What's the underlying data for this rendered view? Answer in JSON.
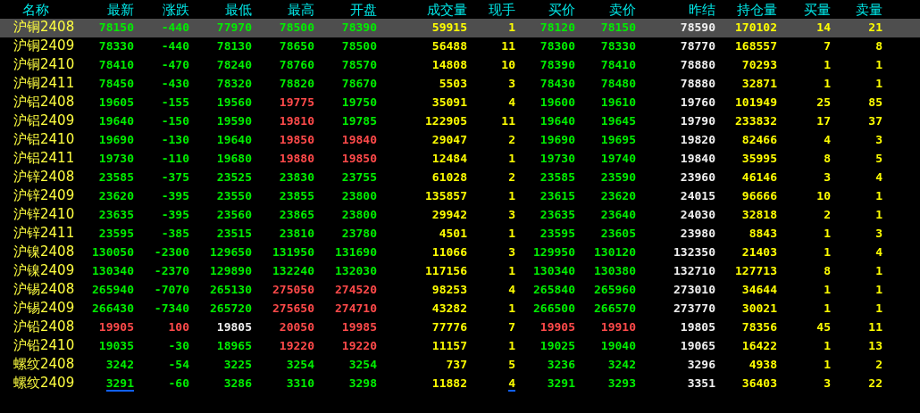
{
  "columns": [
    {
      "label": "名称",
      "marked": false
    },
    {
      "label": "最新",
      "marked": true
    },
    {
      "label": "涨跌",
      "marked": false
    },
    {
      "label": "最低",
      "marked": false
    },
    {
      "label": "最高",
      "marked": false
    },
    {
      "label": "开盘",
      "marked": false
    },
    {
      "label": "成交量",
      "marked": false
    },
    {
      "label": "现手",
      "marked": true
    },
    {
      "label": "买价",
      "marked": false
    },
    {
      "label": "卖价",
      "marked": false
    },
    {
      "label": "昨结",
      "marked": false
    },
    {
      "label": "持仓量",
      "marked": false
    },
    {
      "label": "买量",
      "marked": false
    },
    {
      "label": "卖量",
      "marked": false
    }
  ],
  "rows": [
    {
      "selected": true,
      "cells": [
        {
          "text": "沪铜2408",
          "color": "#ffff40"
        },
        {
          "text": "78150",
          "color": "#00ee00"
        },
        {
          "text": "-440",
          "color": "#00ee00"
        },
        {
          "text": "77970",
          "color": "#00ee00"
        },
        {
          "text": "78500",
          "color": "#00ee00"
        },
        {
          "text": "78390",
          "color": "#00ee00"
        },
        {
          "text": "59915",
          "color": "#ffff00"
        },
        {
          "text": "1",
          "color": "#ffff00"
        },
        {
          "text": "78120",
          "color": "#00ee00"
        },
        {
          "text": "78150",
          "color": "#00ee00"
        },
        {
          "text": "78590",
          "color": "#f0f0f0"
        },
        {
          "text": "170102",
          "color": "#ffff00"
        },
        {
          "text": "14",
          "color": "#ffff00"
        },
        {
          "text": "21",
          "color": "#ffff00"
        }
      ]
    },
    {
      "selected": false,
      "cells": [
        {
          "text": "沪铜2409",
          "color": "#ffff40"
        },
        {
          "text": "78330",
          "color": "#00ee00"
        },
        {
          "text": "-440",
          "color": "#00ee00"
        },
        {
          "text": "78130",
          "color": "#00ee00"
        },
        {
          "text": "78650",
          "color": "#00ee00"
        },
        {
          "text": "78500",
          "color": "#00ee00"
        },
        {
          "text": "56488",
          "color": "#ffff00"
        },
        {
          "text": "11",
          "color": "#ffff00"
        },
        {
          "text": "78300",
          "color": "#00ee00"
        },
        {
          "text": "78330",
          "color": "#00ee00"
        },
        {
          "text": "78770",
          "color": "#f0f0f0"
        },
        {
          "text": "168557",
          "color": "#ffff00"
        },
        {
          "text": "7",
          "color": "#ffff00"
        },
        {
          "text": "8",
          "color": "#ffff00"
        }
      ]
    },
    {
      "selected": false,
      "cells": [
        {
          "text": "沪铜2410",
          "color": "#ffff40"
        },
        {
          "text": "78410",
          "color": "#00ee00"
        },
        {
          "text": "-470",
          "color": "#00ee00"
        },
        {
          "text": "78240",
          "color": "#00ee00"
        },
        {
          "text": "78760",
          "color": "#00ee00"
        },
        {
          "text": "78570",
          "color": "#00ee00"
        },
        {
          "text": "14808",
          "color": "#ffff00"
        },
        {
          "text": "10",
          "color": "#ffff00"
        },
        {
          "text": "78390",
          "color": "#00ee00"
        },
        {
          "text": "78410",
          "color": "#00ee00"
        },
        {
          "text": "78880",
          "color": "#f0f0f0"
        },
        {
          "text": "70293",
          "color": "#ffff00"
        },
        {
          "text": "1",
          "color": "#ffff00"
        },
        {
          "text": "1",
          "color": "#ffff00"
        }
      ]
    },
    {
      "selected": false,
      "cells": [
        {
          "text": "沪铜2411",
          "color": "#ffff40"
        },
        {
          "text": "78450",
          "color": "#00ee00"
        },
        {
          "text": "-430",
          "color": "#00ee00"
        },
        {
          "text": "78320",
          "color": "#00ee00"
        },
        {
          "text": "78820",
          "color": "#00ee00"
        },
        {
          "text": "78670",
          "color": "#00ee00"
        },
        {
          "text": "5503",
          "color": "#ffff00"
        },
        {
          "text": "3",
          "color": "#ffff00"
        },
        {
          "text": "78430",
          "color": "#00ee00"
        },
        {
          "text": "78480",
          "color": "#00ee00"
        },
        {
          "text": "78880",
          "color": "#f0f0f0"
        },
        {
          "text": "32871",
          "color": "#ffff00"
        },
        {
          "text": "1",
          "color": "#ffff00"
        },
        {
          "text": "1",
          "color": "#ffff00"
        }
      ]
    },
    {
      "selected": false,
      "cells": [
        {
          "text": "沪铝2408",
          "color": "#ffff40"
        },
        {
          "text": "19605",
          "color": "#00ee00"
        },
        {
          "text": "-155",
          "color": "#00ee00"
        },
        {
          "text": "19560",
          "color": "#00ee00"
        },
        {
          "text": "19775",
          "color": "#ff4a4a"
        },
        {
          "text": "19750",
          "color": "#00ee00"
        },
        {
          "text": "35091",
          "color": "#ffff00"
        },
        {
          "text": "4",
          "color": "#ffff00"
        },
        {
          "text": "19600",
          "color": "#00ee00"
        },
        {
          "text": "19610",
          "color": "#00ee00"
        },
        {
          "text": "19760",
          "color": "#f0f0f0"
        },
        {
          "text": "101949",
          "color": "#ffff00"
        },
        {
          "text": "25",
          "color": "#ffff00"
        },
        {
          "text": "85",
          "color": "#ffff00"
        }
      ]
    },
    {
      "selected": false,
      "cells": [
        {
          "text": "沪铝2409",
          "color": "#ffff40"
        },
        {
          "text": "19640",
          "color": "#00ee00"
        },
        {
          "text": "-150",
          "color": "#00ee00"
        },
        {
          "text": "19590",
          "color": "#00ee00"
        },
        {
          "text": "19810",
          "color": "#ff4a4a"
        },
        {
          "text": "19785",
          "color": "#00ee00"
        },
        {
          "text": "122905",
          "color": "#ffff00"
        },
        {
          "text": "11",
          "color": "#ffff00"
        },
        {
          "text": "19640",
          "color": "#00ee00"
        },
        {
          "text": "19645",
          "color": "#00ee00"
        },
        {
          "text": "19790",
          "color": "#f0f0f0"
        },
        {
          "text": "233832",
          "color": "#ffff00"
        },
        {
          "text": "17",
          "color": "#ffff00"
        },
        {
          "text": "37",
          "color": "#ffff00"
        }
      ]
    },
    {
      "selected": false,
      "cells": [
        {
          "text": "沪铝2410",
          "color": "#ffff40"
        },
        {
          "text": "19690",
          "color": "#00ee00"
        },
        {
          "text": "-130",
          "color": "#00ee00"
        },
        {
          "text": "19640",
          "color": "#00ee00"
        },
        {
          "text": "19850",
          "color": "#ff4a4a"
        },
        {
          "text": "19840",
          "color": "#ff4a4a"
        },
        {
          "text": "29047",
          "color": "#ffff00"
        },
        {
          "text": "2",
          "color": "#ffff00"
        },
        {
          "text": "19690",
          "color": "#00ee00"
        },
        {
          "text": "19695",
          "color": "#00ee00"
        },
        {
          "text": "19820",
          "color": "#f0f0f0"
        },
        {
          "text": "82466",
          "color": "#ffff00"
        },
        {
          "text": "4",
          "color": "#ffff00"
        },
        {
          "text": "3",
          "color": "#ffff00"
        }
      ]
    },
    {
      "selected": false,
      "cells": [
        {
          "text": "沪铝2411",
          "color": "#ffff40"
        },
        {
          "text": "19730",
          "color": "#00ee00"
        },
        {
          "text": "-110",
          "color": "#00ee00"
        },
        {
          "text": "19680",
          "color": "#00ee00"
        },
        {
          "text": "19880",
          "color": "#ff4a4a"
        },
        {
          "text": "19850",
          "color": "#ff4a4a"
        },
        {
          "text": "12484",
          "color": "#ffff00"
        },
        {
          "text": "1",
          "color": "#ffff00"
        },
        {
          "text": "19730",
          "color": "#00ee00"
        },
        {
          "text": "19740",
          "color": "#00ee00"
        },
        {
          "text": "19840",
          "color": "#f0f0f0"
        },
        {
          "text": "35995",
          "color": "#ffff00"
        },
        {
          "text": "8",
          "color": "#ffff00"
        },
        {
          "text": "5",
          "color": "#ffff00"
        }
      ]
    },
    {
      "selected": false,
      "cells": [
        {
          "text": "沪锌2408",
          "color": "#ffff40"
        },
        {
          "text": "23585",
          "color": "#00ee00"
        },
        {
          "text": "-375",
          "color": "#00ee00"
        },
        {
          "text": "23525",
          "color": "#00ee00"
        },
        {
          "text": "23830",
          "color": "#00ee00"
        },
        {
          "text": "23755",
          "color": "#00ee00"
        },
        {
          "text": "61028",
          "color": "#ffff00"
        },
        {
          "text": "2",
          "color": "#ffff00"
        },
        {
          "text": "23585",
          "color": "#00ee00"
        },
        {
          "text": "23590",
          "color": "#00ee00"
        },
        {
          "text": "23960",
          "color": "#f0f0f0"
        },
        {
          "text": "46146",
          "color": "#ffff00"
        },
        {
          "text": "3",
          "color": "#ffff00"
        },
        {
          "text": "4",
          "color": "#ffff00"
        }
      ]
    },
    {
      "selected": false,
      "cells": [
        {
          "text": "沪锌2409",
          "color": "#ffff40"
        },
        {
          "text": "23620",
          "color": "#00ee00"
        },
        {
          "text": "-395",
          "color": "#00ee00"
        },
        {
          "text": "23550",
          "color": "#00ee00"
        },
        {
          "text": "23855",
          "color": "#00ee00"
        },
        {
          "text": "23800",
          "color": "#00ee00"
        },
        {
          "text": "135857",
          "color": "#ffff00"
        },
        {
          "text": "1",
          "color": "#ffff00"
        },
        {
          "text": "23615",
          "color": "#00ee00"
        },
        {
          "text": "23620",
          "color": "#00ee00"
        },
        {
          "text": "24015",
          "color": "#f0f0f0"
        },
        {
          "text": "96666",
          "color": "#ffff00"
        },
        {
          "text": "10",
          "color": "#ffff00"
        },
        {
          "text": "1",
          "color": "#ffff00"
        }
      ]
    },
    {
      "selected": false,
      "cells": [
        {
          "text": "沪锌2410",
          "color": "#ffff40"
        },
        {
          "text": "23635",
          "color": "#00ee00"
        },
        {
          "text": "-395",
          "color": "#00ee00"
        },
        {
          "text": "23560",
          "color": "#00ee00"
        },
        {
          "text": "23865",
          "color": "#00ee00"
        },
        {
          "text": "23800",
          "color": "#00ee00"
        },
        {
          "text": "29942",
          "color": "#ffff00"
        },
        {
          "text": "3",
          "color": "#ffff00"
        },
        {
          "text": "23635",
          "color": "#00ee00"
        },
        {
          "text": "23640",
          "color": "#00ee00"
        },
        {
          "text": "24030",
          "color": "#f0f0f0"
        },
        {
          "text": "32818",
          "color": "#ffff00"
        },
        {
          "text": "2",
          "color": "#ffff00"
        },
        {
          "text": "1",
          "color": "#ffff00"
        }
      ]
    },
    {
      "selected": false,
      "cells": [
        {
          "text": "沪锌2411",
          "color": "#ffff40"
        },
        {
          "text": "23595",
          "color": "#00ee00"
        },
        {
          "text": "-385",
          "color": "#00ee00"
        },
        {
          "text": "23515",
          "color": "#00ee00"
        },
        {
          "text": "23810",
          "color": "#00ee00"
        },
        {
          "text": "23780",
          "color": "#00ee00"
        },
        {
          "text": "4501",
          "color": "#ffff00"
        },
        {
          "text": "1",
          "color": "#ffff00"
        },
        {
          "text": "23595",
          "color": "#00ee00"
        },
        {
          "text": "23605",
          "color": "#00ee00"
        },
        {
          "text": "23980",
          "color": "#f0f0f0"
        },
        {
          "text": "8843",
          "color": "#ffff00"
        },
        {
          "text": "1",
          "color": "#ffff00"
        },
        {
          "text": "3",
          "color": "#ffff00"
        }
      ]
    },
    {
      "selected": false,
      "cells": [
        {
          "text": "沪镍2408",
          "color": "#ffff40"
        },
        {
          "text": "130050",
          "color": "#00ee00"
        },
        {
          "text": "-2300",
          "color": "#00ee00"
        },
        {
          "text": "129650",
          "color": "#00ee00"
        },
        {
          "text": "131950",
          "color": "#00ee00"
        },
        {
          "text": "131690",
          "color": "#00ee00"
        },
        {
          "text": "11066",
          "color": "#ffff00"
        },
        {
          "text": "3",
          "color": "#ffff00"
        },
        {
          "text": "129950",
          "color": "#00ee00"
        },
        {
          "text": "130120",
          "color": "#00ee00"
        },
        {
          "text": "132350",
          "color": "#f0f0f0"
        },
        {
          "text": "21403",
          "color": "#ffff00"
        },
        {
          "text": "1",
          "color": "#ffff00"
        },
        {
          "text": "4",
          "color": "#ffff00"
        }
      ]
    },
    {
      "selected": false,
      "cells": [
        {
          "text": "沪镍2409",
          "color": "#ffff40"
        },
        {
          "text": "130340",
          "color": "#00ee00"
        },
        {
          "text": "-2370",
          "color": "#00ee00"
        },
        {
          "text": "129890",
          "color": "#00ee00"
        },
        {
          "text": "132240",
          "color": "#00ee00"
        },
        {
          "text": "132030",
          "color": "#00ee00"
        },
        {
          "text": "117156",
          "color": "#ffff00"
        },
        {
          "text": "1",
          "color": "#ffff00"
        },
        {
          "text": "130340",
          "color": "#00ee00"
        },
        {
          "text": "130380",
          "color": "#00ee00"
        },
        {
          "text": "132710",
          "color": "#f0f0f0"
        },
        {
          "text": "127713",
          "color": "#ffff00"
        },
        {
          "text": "8",
          "color": "#ffff00"
        },
        {
          "text": "1",
          "color": "#ffff00"
        }
      ]
    },
    {
      "selected": false,
      "cells": [
        {
          "text": "沪锡2408",
          "color": "#ffff40"
        },
        {
          "text": "265940",
          "color": "#00ee00"
        },
        {
          "text": "-7070",
          "color": "#00ee00"
        },
        {
          "text": "265130",
          "color": "#00ee00"
        },
        {
          "text": "275050",
          "color": "#ff4a4a"
        },
        {
          "text": "274520",
          "color": "#ff4a4a"
        },
        {
          "text": "98253",
          "color": "#ffff00"
        },
        {
          "text": "4",
          "color": "#ffff00"
        },
        {
          "text": "265840",
          "color": "#00ee00"
        },
        {
          "text": "265960",
          "color": "#00ee00"
        },
        {
          "text": "273010",
          "color": "#f0f0f0"
        },
        {
          "text": "34644",
          "color": "#ffff00"
        },
        {
          "text": "1",
          "color": "#ffff00"
        },
        {
          "text": "1",
          "color": "#ffff00"
        }
      ]
    },
    {
      "selected": false,
      "cells": [
        {
          "text": "沪锡2409",
          "color": "#ffff40"
        },
        {
          "text": "266430",
          "color": "#00ee00"
        },
        {
          "text": "-7340",
          "color": "#00ee00"
        },
        {
          "text": "265720",
          "color": "#00ee00"
        },
        {
          "text": "275650",
          "color": "#ff4a4a"
        },
        {
          "text": "274710",
          "color": "#ff4a4a"
        },
        {
          "text": "43282",
          "color": "#ffff00"
        },
        {
          "text": "1",
          "color": "#ffff00"
        },
        {
          "text": "266500",
          "color": "#00ee00"
        },
        {
          "text": "266570",
          "color": "#00ee00"
        },
        {
          "text": "273770",
          "color": "#f0f0f0"
        },
        {
          "text": "30021",
          "color": "#ffff00"
        },
        {
          "text": "1",
          "color": "#ffff00"
        },
        {
          "text": "1",
          "color": "#ffff00"
        }
      ]
    },
    {
      "selected": false,
      "cells": [
        {
          "text": "沪铅2408",
          "color": "#ffff40"
        },
        {
          "text": "19905",
          "color": "#ff4a4a"
        },
        {
          "text": "100",
          "color": "#ff4a4a"
        },
        {
          "text": "19805",
          "color": "#f0f0f0"
        },
        {
          "text": "20050",
          "color": "#ff4a4a"
        },
        {
          "text": "19985",
          "color": "#ff4a4a"
        },
        {
          "text": "77776",
          "color": "#ffff00"
        },
        {
          "text": "7",
          "color": "#ffff00"
        },
        {
          "text": "19905",
          "color": "#ff4a4a"
        },
        {
          "text": "19910",
          "color": "#ff4a4a"
        },
        {
          "text": "19805",
          "color": "#f0f0f0"
        },
        {
          "text": "78356",
          "color": "#ffff00"
        },
        {
          "text": "45",
          "color": "#ffff00"
        },
        {
          "text": "11",
          "color": "#ffff00"
        }
      ]
    },
    {
      "selected": false,
      "cells": [
        {
          "text": "沪铅2410",
          "color": "#ffff40"
        },
        {
          "text": "19035",
          "color": "#00ee00"
        },
        {
          "text": "-30",
          "color": "#00ee00"
        },
        {
          "text": "18965",
          "color": "#00ee00"
        },
        {
          "text": "19220",
          "color": "#ff4a4a"
        },
        {
          "text": "19220",
          "color": "#ff4a4a"
        },
        {
          "text": "11157",
          "color": "#ffff00"
        },
        {
          "text": "1",
          "color": "#ffff00"
        },
        {
          "text": "19025",
          "color": "#00ee00"
        },
        {
          "text": "19040",
          "color": "#00ee00"
        },
        {
          "text": "19065",
          "color": "#f0f0f0"
        },
        {
          "text": "16422",
          "color": "#ffff00"
        },
        {
          "text": "1",
          "color": "#ffff00"
        },
        {
          "text": "13",
          "color": "#ffff00"
        }
      ]
    },
    {
      "selected": false,
      "cells": [
        {
          "text": "螺纹2408",
          "color": "#ffff40"
        },
        {
          "text": "3242",
          "color": "#00ee00"
        },
        {
          "text": "-54",
          "color": "#00ee00"
        },
        {
          "text": "3225",
          "color": "#00ee00"
        },
        {
          "text": "3254",
          "color": "#00ee00"
        },
        {
          "text": "3254",
          "color": "#00ee00"
        },
        {
          "text": "737",
          "color": "#ffff00"
        },
        {
          "text": "5",
          "color": "#ffff00"
        },
        {
          "text": "3236",
          "color": "#00ee00"
        },
        {
          "text": "3242",
          "color": "#00ee00"
        },
        {
          "text": "3296",
          "color": "#f0f0f0"
        },
        {
          "text": "4938",
          "color": "#ffff00"
        },
        {
          "text": "1",
          "color": "#ffff00"
        },
        {
          "text": "2",
          "color": "#ffff00"
        }
      ]
    },
    {
      "selected": false,
      "cells": [
        {
          "text": "螺纹2409",
          "color": "#ffff40"
        },
        {
          "text": "3291",
          "color": "#00ee00"
        },
        {
          "text": "-60",
          "color": "#00ee00"
        },
        {
          "text": "3286",
          "color": "#00ee00"
        },
        {
          "text": "3310",
          "color": "#00ee00"
        },
        {
          "text": "3298",
          "color": "#00ee00"
        },
        {
          "text": "11882",
          "color": "#ffff00"
        },
        {
          "text": "4",
          "color": "#ffff00"
        },
        {
          "text": "3291",
          "color": "#00ee00"
        },
        {
          "text": "3293",
          "color": "#00ee00"
        },
        {
          "text": "3351",
          "color": "#f0f0f0"
        },
        {
          "text": "36403",
          "color": "#ffff00"
        },
        {
          "text": "3",
          "color": "#ffff00"
        },
        {
          "text": "22",
          "color": "#ffff00"
        }
      ]
    }
  ]
}
